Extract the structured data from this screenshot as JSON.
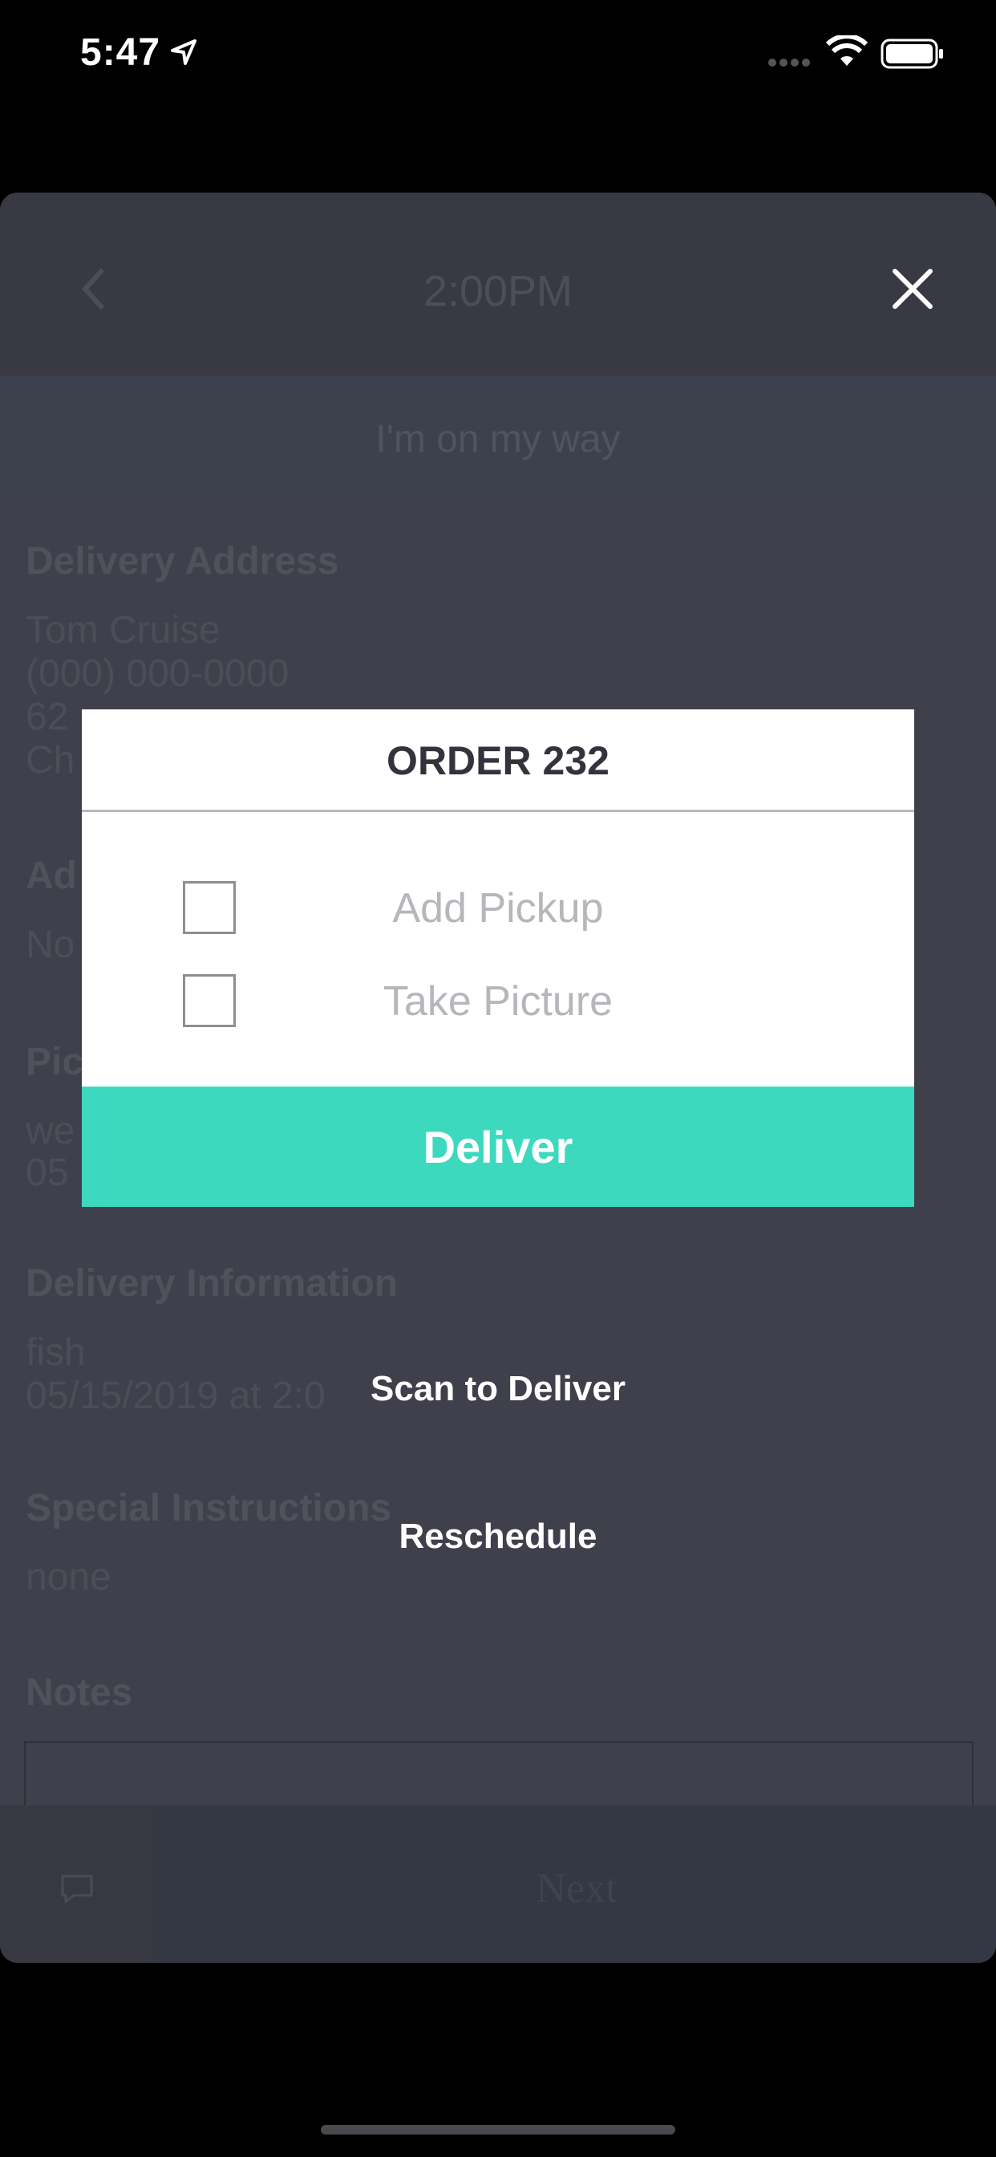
{
  "status_bar": {
    "time": "5:47"
  },
  "header": {
    "title": "2:00PM"
  },
  "on_my_way": {
    "label": "I'm on my way"
  },
  "delivery_address": {
    "title": "Delivery Address",
    "name": "Tom Cruise",
    "phone": "(000) 000-0000",
    "line1": "62",
    "line2": "Ch"
  },
  "section2": {
    "title": "Ad",
    "value": "No"
  },
  "pickup": {
    "title": "Pic",
    "line1": "we",
    "line2": "05"
  },
  "delivery_info": {
    "title": "Delivery Information",
    "item": "fish",
    "date": "05/15/2019 at 2:0"
  },
  "special_instructions": {
    "title": "Special Instructions",
    "value": "none"
  },
  "notes": {
    "title": "Notes"
  },
  "footer": {
    "next_label": "Next"
  },
  "modal": {
    "title": "ORDER 232",
    "options": [
      {
        "label": "Add Pickup",
        "checked": false
      },
      {
        "label": "Take Picture",
        "checked": false
      }
    ],
    "deliver_label": "Deliver",
    "scan_label": "Scan to Deliver",
    "reschedule_label": "Reschedule"
  },
  "colors": {
    "accent": "#3dd9bf",
    "overlay": "#40404c"
  }
}
